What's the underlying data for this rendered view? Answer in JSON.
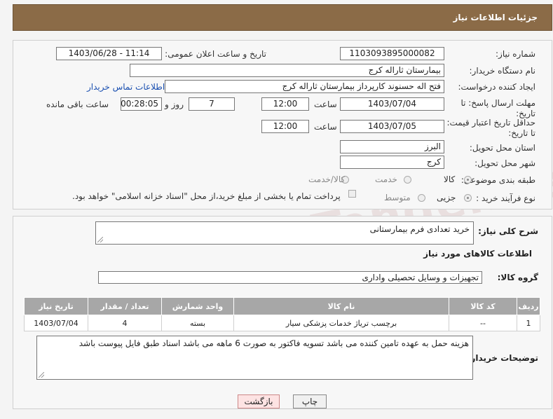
{
  "header": {
    "title": "جزئیات اطلاعات نیاز"
  },
  "fields": {
    "need_number_label": "شماره نیاز:",
    "need_number": "1103093895000082",
    "announce_label": "تاریخ و ساعت اعلان عمومی:",
    "announce_value": "1403/06/28 - 11:14",
    "buyer_org_label": "نام دستگاه خریدار:",
    "buyer_org": "بیمارستان ثاراله کرج",
    "creator_label": "ایجاد کننده درخواست:",
    "creator": "فتح اله حسنوند کارپرداز بیمارستان ثاراله کرج",
    "contact_link": "اطلاعات تماس خریدار",
    "deadline_label": "مهلت ارسال پاسخ: تا تاریخ:",
    "deadline_date": "1403/07/04",
    "time_label": "ساعت",
    "deadline_time": "12:00",
    "days_value": "7",
    "days_label": "روز و",
    "remaining_time": "00:28:05",
    "remaining_label": "ساعت باقی مانده",
    "validity_label": "حداقل تاریخ اعتبار قیمت: تا تاریخ:",
    "validity_date": "1403/07/05",
    "validity_time": "12:00",
    "province_label": "استان محل تحویل:",
    "province": "البرز",
    "city_label": "شهر محل تحویل:",
    "city": "کرج",
    "category_label": "طبقه بندی موضوعی:",
    "category_options": [
      "کالا",
      "خدمت",
      "کالا/خدمت"
    ],
    "purchase_label": "نوع فرآیند خرید :",
    "purchase_options": [
      "جزیی",
      "متوسط"
    ],
    "payment_note": "پرداخت تمام یا بخشی از مبلغ خرید،از محل \"اسناد خزانه اسلامی\" خواهد بود."
  },
  "details": {
    "summary_label": "شرح کلی نیاز:",
    "summary": "خرید تعدادی فرم بیمارستانی",
    "goods_info_title": "اطلاعات کالاهای مورد نیاز",
    "goods_group_label": "گروه کالا:",
    "goods_group": "تجهیزات و وسایل تحصیلی واداری",
    "table": {
      "headers": [
        "ردیف",
        "کد کالا",
        "نام کالا",
        "واحد شمارش",
        "تعداد / مقدار",
        "تاریخ نیاز"
      ],
      "rows": [
        [
          "1",
          "--",
          "برچسب ترياژ خدمات پزشکی سيار",
          "بسته",
          "4",
          "1403/07/04"
        ]
      ]
    },
    "buyer_notes_label": "توضیحات خریدار:",
    "buyer_notes": "هزینه حمل به عهده تامین کننده می باشد تسویه فاکتور به صورت 6 ماهه می باشد اسناد طبق فایل پیوست باشد"
  },
  "buttons": {
    "print": "چاپ",
    "back": "بازگشت"
  },
  "watermark": "AriaTender.neT"
}
